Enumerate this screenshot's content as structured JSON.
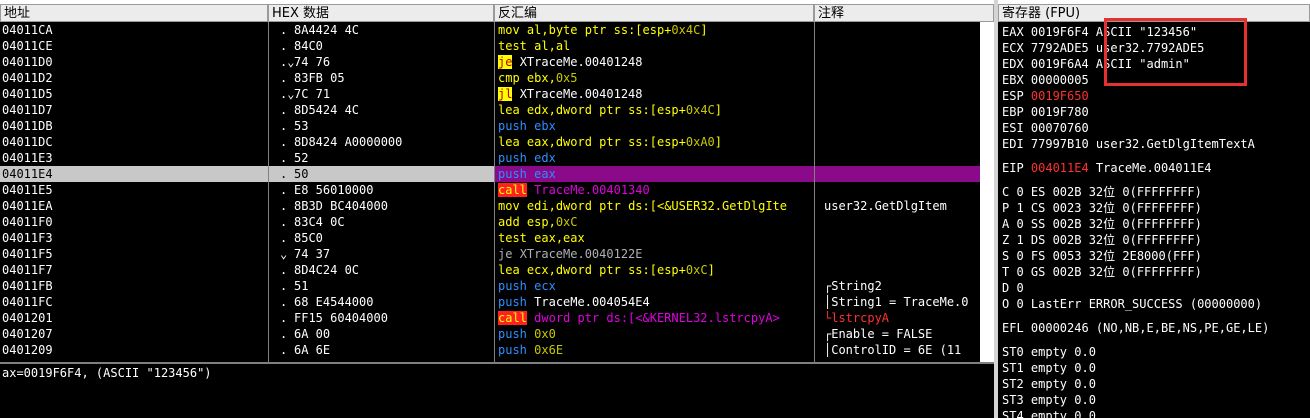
{
  "headers": [
    "地址",
    "HEX 数据",
    "反汇编",
    "注释"
  ],
  "reg_header": "寄存器 (FPU)",
  "rows": [
    {
      "addr": "04011CA",
      "mark": ".",
      "hex": "8A4424 4C",
      "style": "norm",
      "kw": "mov",
      "ops": "al,byte ptr ss:[esp+",
      "imm": "0x4C",
      "close": "]",
      "comment": ""
    },
    {
      "addr": "04011CE",
      "mark": ".",
      "hex": "84C0",
      "style": "norm",
      "kw": "test",
      "ops": "al,al",
      "imm": "",
      "close": "",
      "comment": ""
    },
    {
      "addr": "04011D0",
      "mark": ".⌄",
      "hex": "74 76",
      "style": "jmp",
      "kw": "je",
      "ops": "XTraceMe.00401248",
      "imm": "",
      "close": "",
      "comment": ""
    },
    {
      "addr": "04011D2",
      "mark": ".",
      "hex": "83FB 05",
      "style": "norm",
      "kw": "cmp",
      "ops": "ebx,",
      "imm": "0x5",
      "close": "",
      "comment": ""
    },
    {
      "addr": "04011D5",
      "mark": ".⌄",
      "hex": "7C 71",
      "style": "jmp",
      "kw": "jl",
      "ops": "XTraceMe.00401248",
      "imm": "",
      "close": "",
      "comment": ""
    },
    {
      "addr": "04011D7",
      "mark": ".",
      "hex": "8D5424 4C",
      "style": "norm",
      "kw": "lea",
      "ops": "edx,dword ptr ss:[esp+",
      "imm": "0x4C",
      "close": "]",
      "comment": ""
    },
    {
      "addr": "04011DB",
      "mark": ".",
      "hex": "53",
      "style": "push",
      "kw": "push",
      "ops": "ebx",
      "imm": "",
      "close": "",
      "comment": ""
    },
    {
      "addr": "04011DC",
      "mark": ".",
      "hex": "8D8424 A0000000",
      "style": "norm",
      "kw": "lea",
      "ops": "eax,dword ptr ss:[esp+",
      "imm": "0xA0",
      "close": "]",
      "comment": ""
    },
    {
      "addr": "04011E3",
      "mark": ".",
      "hex": "52",
      "style": "push",
      "kw": "push",
      "ops": "edx",
      "imm": "",
      "close": "",
      "comment": ""
    },
    {
      "addr": "04011E4",
      "mark": ".",
      "hex": "50",
      "style": "push",
      "kw": "push",
      "ops": "eax",
      "imm": "",
      "close": "",
      "comment": "",
      "selected": true
    },
    {
      "addr": "04011E5",
      "mark": ".",
      "hex": "E8 56010000",
      "style": "call",
      "kw": "call",
      "ops": "TraceMe.00401340",
      "imm": "",
      "close": "",
      "comment": ""
    },
    {
      "addr": "04011EA",
      "mark": ".",
      "hex": "8B3D BC404000",
      "style": "norm",
      "kw": "mov",
      "ops": "edi,dword ptr ds:[<&USER32.GetDlgIte",
      "imm": "",
      "close": "",
      "comment": "user32.GetDlgItem"
    },
    {
      "addr": "04011F0",
      "mark": ".",
      "hex": "83C4 0C",
      "style": "norm",
      "kw": "add",
      "ops": "esp,",
      "imm": "0xC",
      "close": "",
      "comment": ""
    },
    {
      "addr": "04011F3",
      "mark": ".",
      "hex": "85C0",
      "style": "norm",
      "kw": "test",
      "ops": "eax,eax",
      "imm": "",
      "close": "",
      "comment": ""
    },
    {
      "addr": "04011F5",
      "mark": "⌄",
      "hex": "74 37",
      "style": "dim",
      "kw": "je",
      "ops": "XTraceMe.0040122E",
      "imm": "",
      "close": "",
      "comment": ""
    },
    {
      "addr": "04011F7",
      "mark": ".",
      "hex": "8D4C24 0C",
      "style": "norm",
      "kw": "lea",
      "ops": "ecx,dword ptr ss:[esp+",
      "imm": "0xC",
      "close": "]",
      "comment": ""
    },
    {
      "addr": "04011FB",
      "mark": ".",
      "hex": "51",
      "style": "push",
      "kw": "push",
      "ops": "ecx",
      "imm": "",
      "close": "",
      "comment": "┌String2"
    },
    {
      "addr": "04011FC",
      "mark": ".",
      "hex": "68 E4544000",
      "style": "push",
      "kw": "push",
      "ops": "TraceMe.004054E4",
      "imm": "",
      "close": "",
      "comment": "│String1 = TraceMe.0"
    },
    {
      "addr": "0401201",
      "mark": ".",
      "hex": "FF15 60404000",
      "style": "call",
      "kw": "call",
      "ops": "dword ptr ds:[<&KERNEL32.lstrcpyA>",
      "imm": "",
      "close": "",
      "comment": "└lstrcpyA"
    },
    {
      "addr": "0401207",
      "mark": ".",
      "hex": "6A 00",
      "style": "push",
      "kw": "push",
      "ops": "",
      "imm": "0x0",
      "close": "",
      "comment": "┌Enable = FALSE"
    },
    {
      "addr": "0401209",
      "mark": ".",
      "hex": "6A 6E",
      "style": "push",
      "kw": "push",
      "ops": "",
      "imm": "0x6E",
      "close": "",
      "comment": "│ControlID = 6E (11"
    }
  ],
  "info_line": "ax=0019F6F4, (ASCII \"123456\")",
  "registers": [
    {
      "name": "EAX",
      "val": "0019F6F4",
      "note": "ASCII \"123456\""
    },
    {
      "name": "ECX",
      "val": "7792ADE5",
      "note": "user32.7792ADE5"
    },
    {
      "name": "EDX",
      "val": "0019F6A4",
      "note": "ASCII \"admin\""
    },
    {
      "name": "EBX",
      "val": "00000005",
      "note": ""
    },
    {
      "name": "ESP",
      "val": "0019F650",
      "note": "",
      "red": true
    },
    {
      "name": "EBP",
      "val": "0019F780",
      "note": ""
    },
    {
      "name": "ESI",
      "val": "00070760",
      "note": ""
    },
    {
      "name": "EDI",
      "val": "77997B10",
      "note": "user32.GetDlgItemTextA"
    }
  ],
  "eip": {
    "name": "EIP",
    "val": "004011E4",
    "note": "TraceMe.004011E4"
  },
  "flags": [
    "C 0  ES 002B 32位 0(FFFFFFFF)",
    "P 1  CS 0023 32位 0(FFFFFFFF)",
    "A 0  SS 002B 32位 0(FFFFFFFF)",
    "Z 1  DS 002B 32位 0(FFFFFFFF)",
    "S 0  FS 0053 32位 2E8000(FFF)",
    "T 0  GS 002B 32位 0(FFFFFFFF)",
    "D 0",
    "O 0  LastErr ERROR_SUCCESS (00000000)"
  ],
  "efl": "EFL 00000246 (NO,NB,E,BE,NS,PE,GE,LE)",
  "fpu": [
    "ST0 empty 0.0",
    "ST1 empty 0.0",
    "ST2 empty 0.0",
    "ST3 empty 0.0",
    "ST4 empty 0.0"
  ]
}
